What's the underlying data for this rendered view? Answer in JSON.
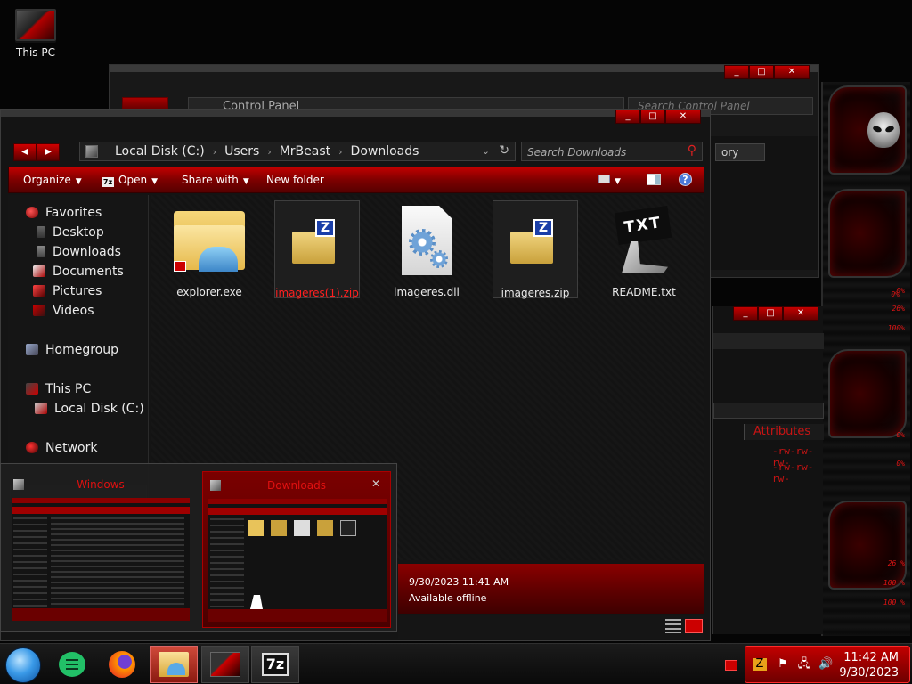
{
  "desktop": {
    "this_pc_label": "This PC"
  },
  "control_panel": {
    "address": "Control Panel",
    "search_placeholder": "Search Control Panel",
    "category_label": "ory"
  },
  "list_window": {
    "column_header": "Attributes",
    "attributes": [
      "-rw-rw-rw-",
      "-rw-rw-rw-"
    ]
  },
  "explorer": {
    "title": "Downloads",
    "breadcrumb": [
      "Local Disk (C:)",
      "Users",
      "MrBeast",
      "Downloads"
    ],
    "search_placeholder": "Search Downloads",
    "toolbar": {
      "organize": "Organize",
      "open": "Open",
      "share_with": "Share with",
      "new_folder": "New folder",
      "open_icon_text": "7z",
      "help_text": "?"
    },
    "nav": {
      "favorites": "Favorites",
      "desktop": "Desktop",
      "downloads": "Downloads",
      "documents": "Documents",
      "pictures": "Pictures",
      "videos": "Videos",
      "homegroup": "Homegroup",
      "this_pc": "This PC",
      "local_disk": "Local Disk (C:)",
      "network": "Network"
    },
    "files": [
      {
        "name": "explorer.exe",
        "icon": "explorer-folder-icon"
      },
      {
        "name": "imageres(1).zip",
        "icon": "7zip-archive-icon",
        "state": "selected"
      },
      {
        "name": "imageres.dll",
        "icon": "dll-gear-icon"
      },
      {
        "name": "imageres.zip",
        "icon": "7zip-archive-icon",
        "state": "hover"
      },
      {
        "name": "README.txt",
        "icon": "txt-sign-icon"
      }
    ],
    "txt_icon_text": "TXT",
    "zip_icon_text": "Z",
    "details": {
      "date_modified": "9/30/2023 11:41 AM",
      "availability": "Available offline"
    }
  },
  "thumbnails": [
    {
      "title": "Windows"
    },
    {
      "title": "Downloads",
      "active": true
    }
  ],
  "taskbar": {
    "apps": [
      "globe-icon",
      "chat-icon",
      "firefox-icon",
      "file-explorer-icon",
      "alienware-icon",
      "7zip-icon"
    ],
    "sevenzip_text": "7z",
    "clock": {
      "time": "11:42 AM",
      "date": "9/30/2023"
    }
  },
  "gadget": {
    "percent_values": [
      "0%",
      "26%",
      "100%",
      "0%",
      "0%",
      "26 %",
      "100 %",
      "100 %"
    ]
  },
  "colors": {
    "accent_red": "#c00000",
    "selected_file_text": "#ff2020",
    "start_orb": "#3a9ae8"
  }
}
